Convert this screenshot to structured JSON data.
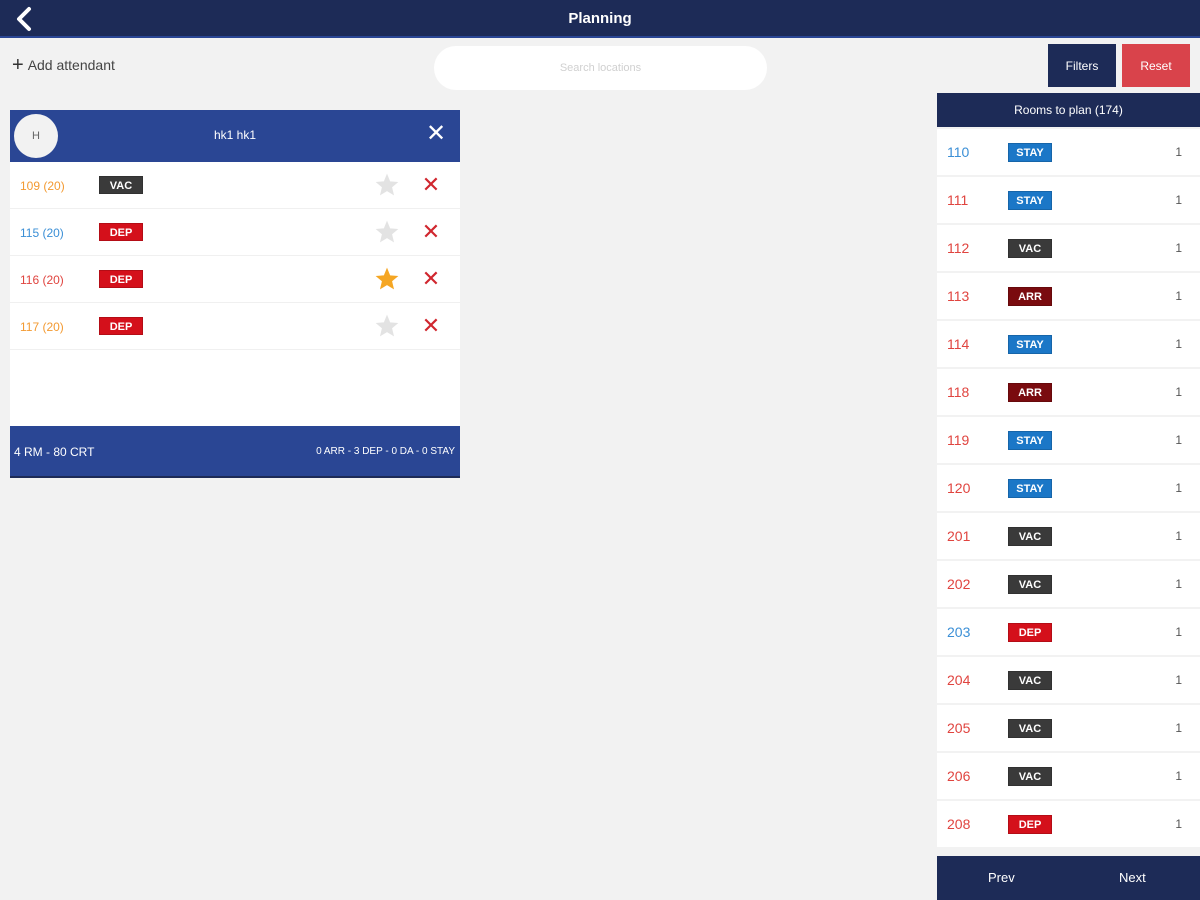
{
  "header": {
    "title": "Planning",
    "back_icon": "chevron-left-icon"
  },
  "toolbar": {
    "add_attendant_icon": "plus-icon",
    "add_attendant_label": "Add attendant",
    "search_placeholder": "Search locations",
    "search_value": "",
    "filters_label": "Filters",
    "reset_label": "Reset"
  },
  "colors": {
    "navy": "#1d2b57",
    "blue": "#2a4694",
    "reset_red": "#d9434b",
    "VAC": "#3a3a3a",
    "DEP": "#d4101b",
    "ARR": "#7a0b0f",
    "STAY": "#1b77c7",
    "text_orange": "#f39a32",
    "text_blue": "#3b8fd6",
    "text_red": "#e0443f",
    "star_active": "#f5a623",
    "star_inactive": "#e3e3e3"
  },
  "attendant": {
    "avatar_initial": "H",
    "name": "hk1 hk1",
    "close_icon": "close-icon",
    "rooms": [
      {
        "label": "109 (20)",
        "color": "orange",
        "status": "VAC",
        "favorite": false
      },
      {
        "label": "115 (20)",
        "color": "blue",
        "status": "DEP",
        "favorite": false
      },
      {
        "label": "116 (20)",
        "color": "red",
        "status": "DEP",
        "favorite": true
      },
      {
        "label": "117 (20)",
        "color": "orange",
        "status": "DEP",
        "favorite": false
      }
    ],
    "summary_left": "4 RM - 80 CRT",
    "summary_right": "0 ARR - 3 DEP - 0 DA - 0 STAY"
  },
  "rooms_panel": {
    "title": "Rooms to plan (174)",
    "rooms": [
      {
        "number": "110",
        "color": "blue",
        "status": "STAY",
        "count": "1"
      },
      {
        "number": "111",
        "color": "red",
        "status": "STAY",
        "count": "1"
      },
      {
        "number": "112",
        "color": "red",
        "status": "VAC",
        "count": "1"
      },
      {
        "number": "113",
        "color": "red",
        "status": "ARR",
        "count": "1"
      },
      {
        "number": "114",
        "color": "red",
        "status": "STAY",
        "count": "1"
      },
      {
        "number": "118",
        "color": "red",
        "status": "ARR",
        "count": "1"
      },
      {
        "number": "119",
        "color": "red",
        "status": "STAY",
        "count": "1"
      },
      {
        "number": "120",
        "color": "red",
        "status": "STAY",
        "count": "1"
      },
      {
        "number": "201",
        "color": "red",
        "status": "VAC",
        "count": "1"
      },
      {
        "number": "202",
        "color": "red",
        "status": "VAC",
        "count": "1"
      },
      {
        "number": "203",
        "color": "blue",
        "status": "DEP",
        "count": "1"
      },
      {
        "number": "204",
        "color": "red",
        "status": "VAC",
        "count": "1"
      },
      {
        "number": "205",
        "color": "red",
        "status": "VAC",
        "count": "1"
      },
      {
        "number": "206",
        "color": "red",
        "status": "VAC",
        "count": "1"
      },
      {
        "number": "208",
        "color": "red",
        "status": "DEP",
        "count": "1"
      }
    ],
    "prev_label": "Prev",
    "next_label": "Next"
  }
}
